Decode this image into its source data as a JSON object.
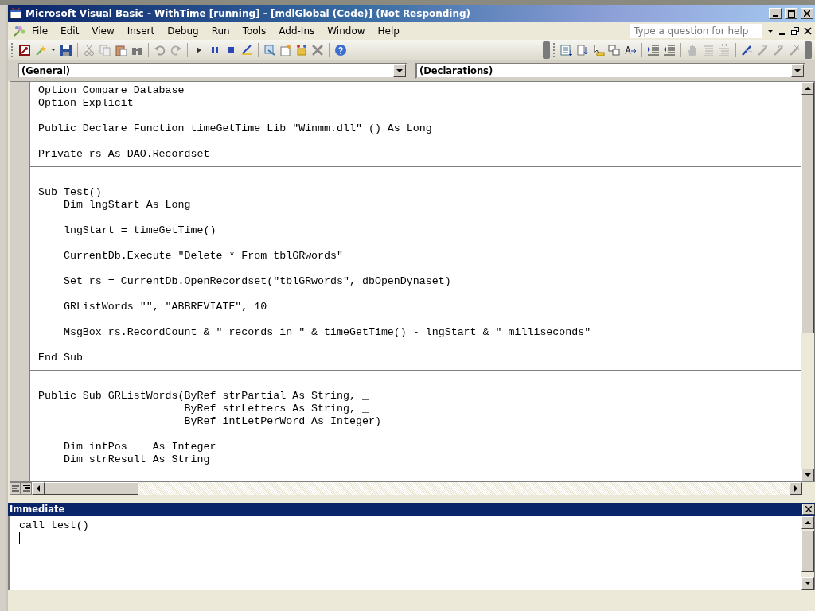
{
  "window": {
    "title": "Microsoft Visual Basic - WithTime [running] - [mdlGlobal (Code)] (Not Responding)"
  },
  "menu": [
    "File",
    "Edit",
    "View",
    "Insert",
    "Debug",
    "Run",
    "Tools",
    "Add-Ins",
    "Window",
    "Help"
  ],
  "help_box": {
    "placeholder": "Type a question for help"
  },
  "object_combo": {
    "value": "(General)"
  },
  "procedure_combo": {
    "value": "(Declarations)"
  },
  "code": [
    {
      "groups": [
        [
          "Option Compare Database",
          "Option Explicit"
        ],
        [
          "Public Declare Function timeGetTime Lib \"Winmm.dll\" () As Long"
        ],
        [
          "Private rs As DAO.Recordset"
        ]
      ]
    },
    {
      "groups": [
        [
          "Sub Test()",
          "    Dim lngStart As Long"
        ],
        [
          "    lngStart = timeGetTime()"
        ],
        [
          "    CurrentDb.Execute \"Delete * From tblGRwords\""
        ],
        [
          "    Set rs = CurrentDb.OpenRecordset(\"tblGRwords\", dbOpenDynaset)"
        ],
        [
          "    GRListWords \"\", \"ABBREVIATE\", 10"
        ],
        [
          "    MsgBox rs.RecordCount & \" records in \" & timeGetTime() - lngStart & \" milliseconds\""
        ],
        [
          "End Sub"
        ]
      ]
    },
    {
      "groups": [
        [
          "Public Sub GRListWords(ByRef strPartial As String, _",
          "                       ByRef strLetters As String, _",
          "                       ByRef intLetPerWord As Integer)"
        ],
        [
          "    Dim intPos    As Integer",
          "    Dim strResult As String"
        ]
      ]
    }
  ],
  "immediate": {
    "title": "Immediate",
    "lines": [
      "call test()"
    ]
  }
}
